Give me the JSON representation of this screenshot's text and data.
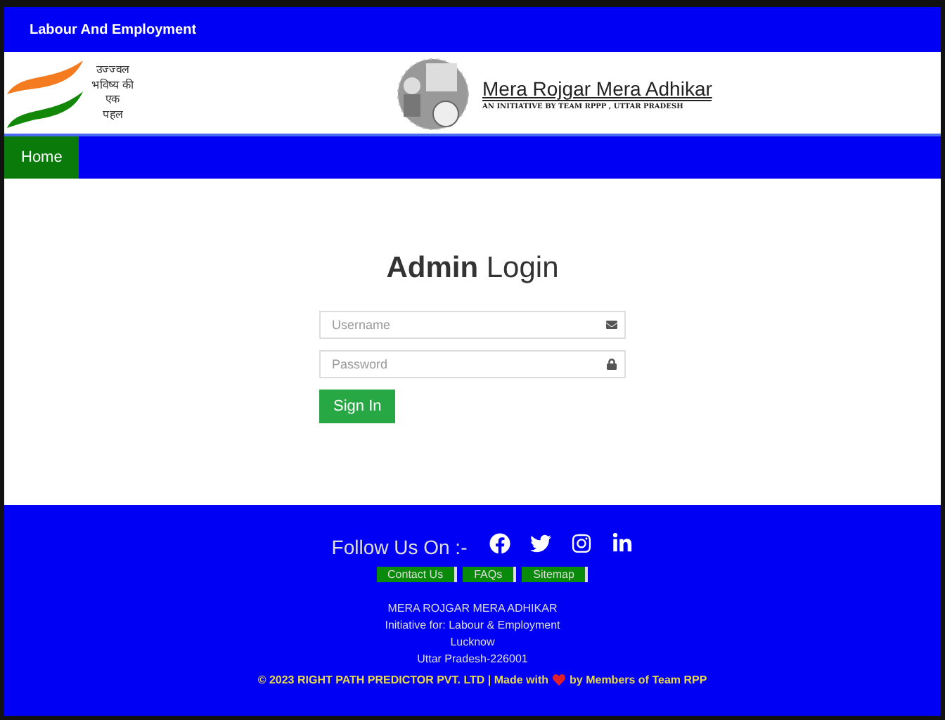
{
  "top_bar": {
    "title": "Labour And Employment"
  },
  "header": {
    "slogan_lines": [
      "उज्ज्वल",
      "भविष्य की",
      "एक",
      "पहल"
    ],
    "brand_title": "Mera Rojgar Mera Adhikar",
    "brand_tagline": "AN INITIATIVE BY TEAM RPPP , UTTAR PRADESH"
  },
  "nav": {
    "items": [
      {
        "label": "Home",
        "selected": true
      }
    ]
  },
  "login": {
    "title": "**Admin** Login",
    "username": {
      "placeholder": "Username"
    },
    "password": {
      "placeholder": "Password"
    },
    "submit": "Sign In"
  },
  "footer": {
    "follow_label": "Follow Us On :-",
    "links": [
      "Contact Us",
      "FAQs",
      "Sitemap"
    ],
    "address_lines": [
      "MERA ROJGAR MERA ADHIKAR",
      "Initiative for: Labour & Employment",
      "Lucknow",
      "Uttar Pradesh-226001"
    ],
    "copyright_before": "© 2023 RIGHT PATH PREDICTOR PVT. LTD | Made with",
    "copyright_after": "by Members of Team RPP"
  }
}
